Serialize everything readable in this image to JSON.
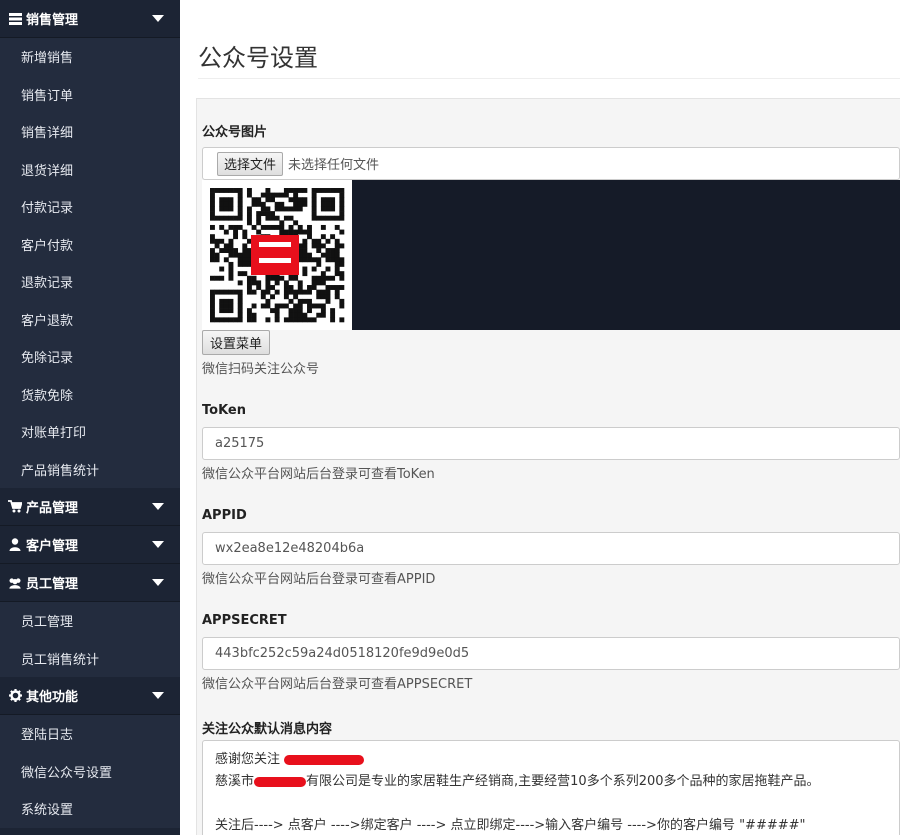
{
  "sidebar": {
    "sections": [
      {
        "label": "销售管理",
        "icon": "table-list-icon",
        "items": [
          {
            "label": "新增销售"
          },
          {
            "label": "销售订单"
          },
          {
            "label": "销售详细"
          },
          {
            "label": "退货详细"
          },
          {
            "label": "付款记录"
          },
          {
            "label": "客户付款"
          },
          {
            "label": "退款记录"
          },
          {
            "label": "客户退款"
          },
          {
            "label": "免除记录"
          },
          {
            "label": "货款免除"
          },
          {
            "label": "对账单打印"
          },
          {
            "label": "产品销售统计"
          }
        ]
      },
      {
        "label": "产品管理",
        "icon": "cart-icon",
        "items": []
      },
      {
        "label": "客户管理",
        "icon": "user-icon",
        "items": []
      },
      {
        "label": "员工管理",
        "icon": "users-icon",
        "items": [
          {
            "label": "员工管理"
          },
          {
            "label": "员工销售统计"
          }
        ]
      },
      {
        "label": "其他功能",
        "icon": "gear-icon",
        "items": [
          {
            "label": "登陆日志"
          },
          {
            "label": "微信公众号设置"
          },
          {
            "label": "系统设置"
          }
        ]
      }
    ]
  },
  "main": {
    "title": "公众号设置",
    "image_field": {
      "label": "公众号图片",
      "file_button": "选择文件",
      "file_status": "未选择任何文件",
      "menu_button": "设置菜单",
      "help": "微信扫码关注公众号"
    },
    "token": {
      "label": "ToKen",
      "value": "a25175",
      "help": "微信公众平台网站后台登录可查看ToKen"
    },
    "appid": {
      "label": "APPID",
      "value": "wx2ea8e12e48204b6a",
      "help": "微信公众平台网站后台登录可查看APPID"
    },
    "appsecret": {
      "label": "APPSECRET",
      "value": "443bfc252c59a24d0518120fe9d9e0d5",
      "help": "微信公众平台网站后台登录可查看APPSECRET"
    },
    "welcome": {
      "label": "关注公众默认消息内容",
      "line1_prefix": "感谢您关注",
      "line2_prefix": "慈溪市",
      "line2_suffix": "有限公司是专业的家居鞋生产经销商,主要经营10多个系列200多个品种的家居拖鞋产品。",
      "line3": "关注后---->    点客户   ---->绑定客户 ---->  点立即绑定---->输入客户编号   ---->你的客户编号  \"#####\""
    }
  },
  "colors": {
    "sidebar_bg": "#1c2434",
    "sidebar_sub_bg": "#232c3e",
    "panel_bg": "#f5f5f5",
    "redaction": "#e8101c"
  }
}
